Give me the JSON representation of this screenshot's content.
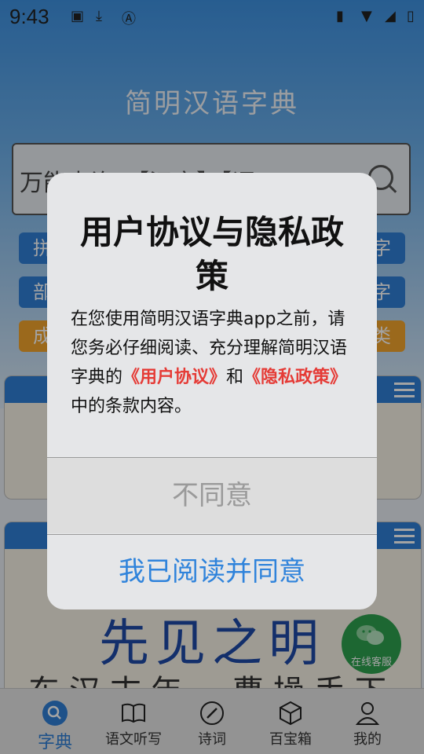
{
  "status_bar": {
    "time": "9:43",
    "icons": [
      "image-icon",
      "download-icon",
      "a-icon",
      "briefcase-icon",
      "wifi-icon",
      "signal-icon",
      "battery-icon"
    ]
  },
  "app": {
    "title": "简明汉语字典",
    "search": {
      "placeholder": "万能查询：【汉字】【词"
    },
    "chips": [
      {
        "label": "拼",
        "color": "#2f7fd7"
      },
      {
        "label": "字",
        "color": "#2f7fd7"
      },
      {
        "label": "部",
        "color": "#2f7fd7"
      },
      {
        "label": "字",
        "color": "#2f7fd7"
      },
      {
        "label": "成",
        "color": "#f3a42d"
      },
      {
        "label": "类",
        "color": "#f3a42d"
      }
    ],
    "card_text": "先见之明",
    "card_text2": "东汉末年，曹操手下",
    "service_label": "在线客服"
  },
  "bottom_nav": [
    {
      "label": "字典",
      "icon": "search-icon",
      "active": true
    },
    {
      "label": "语文听写",
      "icon": "book-icon",
      "active": false
    },
    {
      "label": "诗词",
      "icon": "pen-icon",
      "active": false
    },
    {
      "label": "百宝箱",
      "icon": "box-icon",
      "active": false
    },
    {
      "label": "我的",
      "icon": "person-icon",
      "active": false
    }
  ],
  "dialog": {
    "title": "用户协议与隐私政策",
    "body_prefix": "在您使用简明汉语字典app之前，请您务必仔细阅读、充分理解简明汉语字典的",
    "link_user_agreement": "《用户协议》",
    "body_and": "和",
    "link_privacy": "《隐私政策》",
    "body_suffix": "中的条款内容。",
    "disagree_label": "不同意",
    "agree_label": "我已阅读并同意"
  },
  "colors": {
    "accent": "#2f7fd7",
    "link_red": "#e53b36",
    "orange": "#f3a42d",
    "service_green": "#2ea14f"
  }
}
